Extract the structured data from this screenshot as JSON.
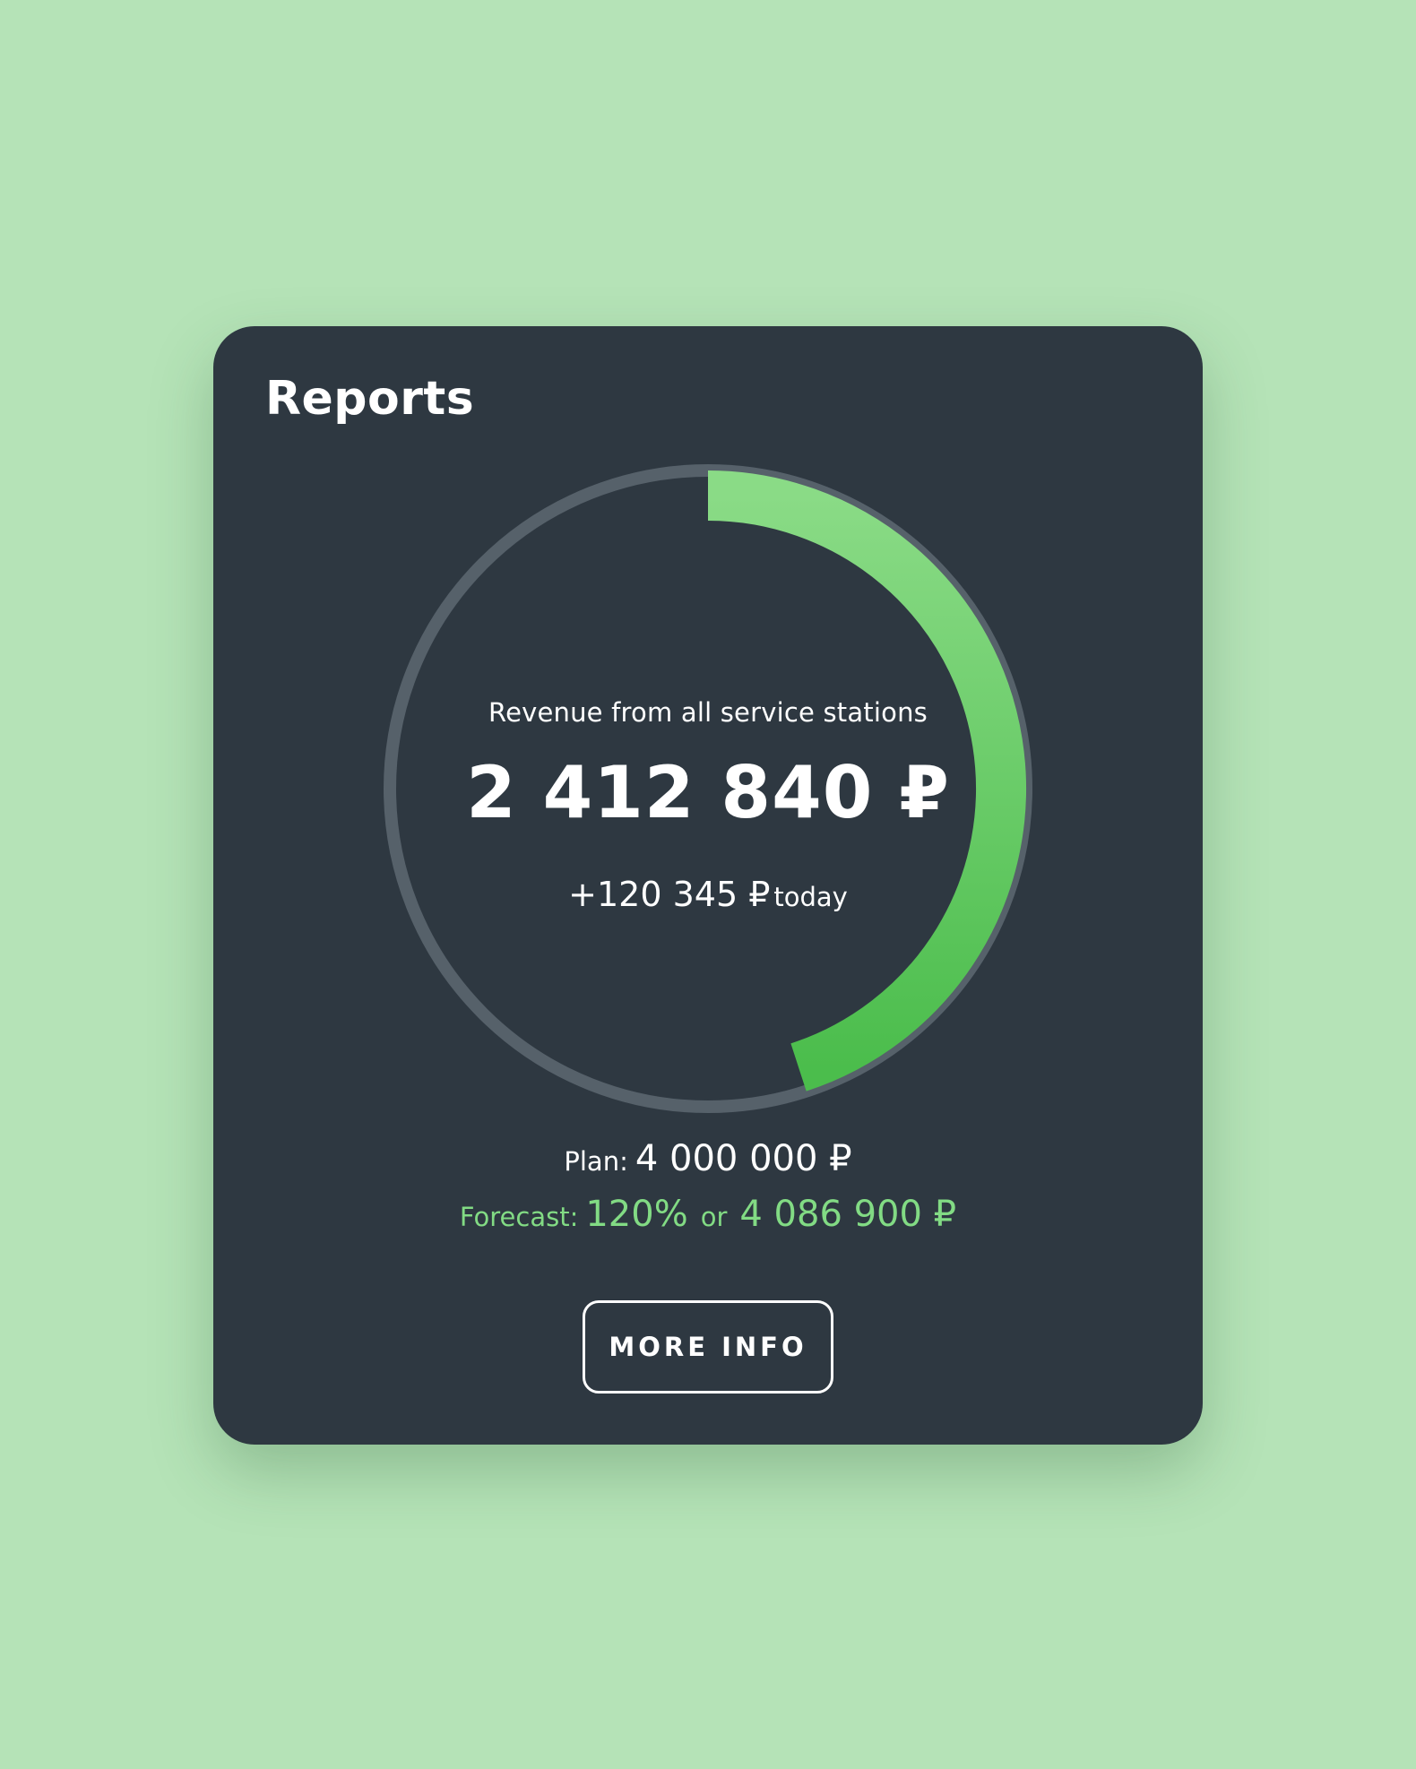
{
  "card": {
    "title": "Reports",
    "subtitle": "Revenue from all service stations",
    "revenue": "2 412 840 ₽",
    "today_value": "+120 345 ₽",
    "today_suffix": "today",
    "plan_label": "Plan:",
    "plan_value": "4 000 000 ₽",
    "forecast_label": "Forecast:",
    "forecast_percent": "120%",
    "forecast_or": "or",
    "forecast_value": "4 086 900 ₽",
    "more_button": "MORE INFO"
  },
  "progress": {
    "fraction": 0.45
  },
  "colors": {
    "page_background": "#b5e3b7",
    "card_background": "#2e3841",
    "ring_track": "#56616a",
    "progress_start": "#8adb86",
    "progress_end": "#4bbd4c",
    "forecast_text": "#82db84",
    "text": "#ffffff"
  }
}
